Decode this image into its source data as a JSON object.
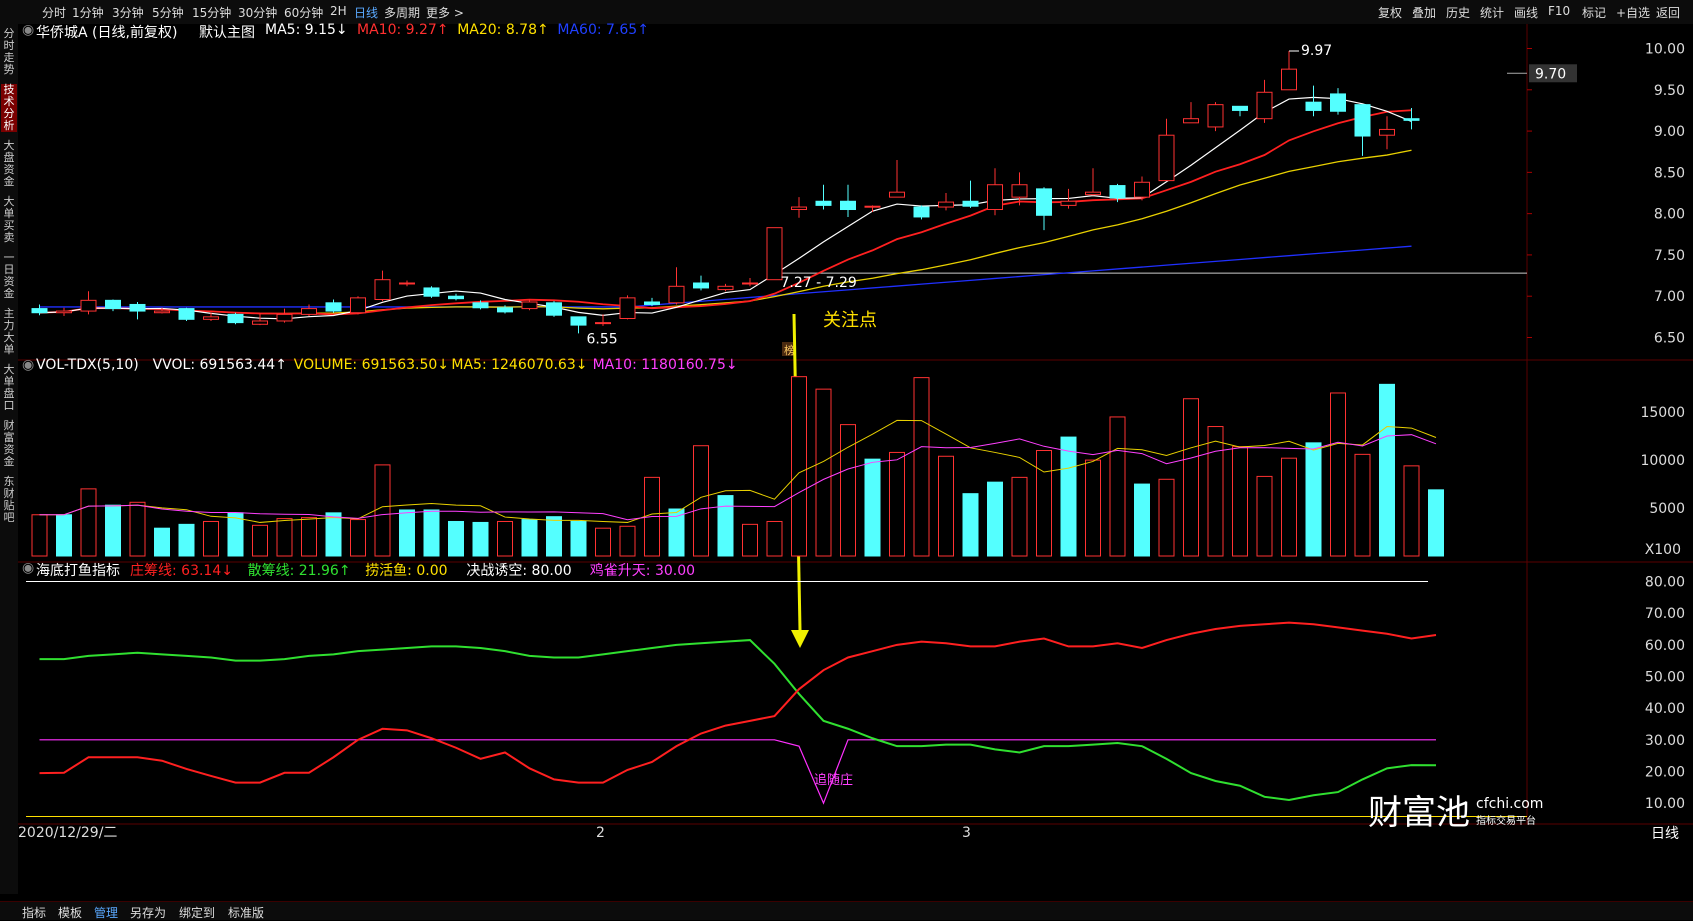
{
  "topbar": {
    "left_items": [
      "分时",
      "1分钟",
      "3分钟",
      "5分钟",
      "15分钟",
      "30分钟",
      "60分钟",
      "2H",
      "日线",
      "多周期",
      "更多 >"
    ],
    "active": "日线",
    "right_items": [
      "复权",
      "叠加",
      "历史",
      "统计",
      "画线",
      "F10",
      "标记",
      "+自选",
      "返回"
    ]
  },
  "side_tabs": [
    "分时走势",
    "技术分析",
    "大盘资金",
    "大单买卖",
    "一日资金",
    "主力大单",
    "大单盘口",
    "财富资金",
    "东财贴吧"
  ],
  "side_active": "技术分析",
  "main_panel": {
    "title": "华侨城A (日线,前复权)",
    "template": "默认主图",
    "indicators": [
      {
        "text": "MA5: 9.15",
        "arrow": "↓",
        "color": "#ffffff"
      },
      {
        "text": "MA10: 9.27",
        "arrow": "↑",
        "color": "#ff3030"
      },
      {
        "text": "MA20: 8.78",
        "arrow": "↑",
        "color": "#ffe000"
      },
      {
        "text": "MA60: 7.65",
        "arrow": "↑",
        "color": "#2040ff"
      }
    ],
    "y_ticks": [
      "10.00",
      "9.50",
      "9.00",
      "8.50",
      "8.00",
      "7.50",
      "7.00",
      "6.50"
    ],
    "y_range": [
      6.3,
      10.2
    ],
    "last_price": "9.70",
    "high_label": "9.97",
    "low_label": "6.55",
    "hline_label": "7.27 - 7.29",
    "annotation": "关注点",
    "badge": "榜"
  },
  "volume_panel": {
    "title": "VOL-TDX(5,10)",
    "indicators": [
      {
        "text": "VVOL: 691563.44",
        "arrow": "↑",
        "color": "#ffffff"
      },
      {
        "text": "VOLUME: 691563.50",
        "arrow": "↓",
        "color": "#ffe000"
      },
      {
        "text": "MA5: 1246070.63",
        "arrow": "↓",
        "color": "#ffe000"
      },
      {
        "text": "MA10: 1180160.75",
        "arrow": "↓",
        "color": "#ff40ff"
      }
    ],
    "y_ticks": [
      "15000",
      "10000",
      "5000"
    ],
    "unit": "X100"
  },
  "indicator_panel": {
    "title": "海底打鱼指标",
    "indicators": [
      {
        "text": "庄筹线: 63.14",
        "arrow": "↓",
        "color": "#ff2020"
      },
      {
        "text": "散筹线: 21.96",
        "arrow": "↑",
        "color": "#30e030"
      },
      {
        "text": "捞活鱼: 0.00",
        "arrow": "",
        "color": "#ffe000"
      },
      {
        "text": "决战诱空: 80.00",
        "arrow": "",
        "color": "#ffffff"
      },
      {
        "text": "鸡雀升天: 30.00",
        "arrow": "",
        "color": "#ff40ff"
      }
    ],
    "y_ticks": [
      "80.00",
      "70.00",
      "60.00",
      "50.00",
      "40.00",
      "30.00",
      "20.00",
      "10.00"
    ],
    "annotation": "追随庄"
  },
  "x_axis": {
    "start": "2020/12/29/二",
    "marks": [
      "2",
      "3"
    ],
    "period": "日线"
  },
  "watermark": {
    "brand": "财富池",
    "site": "cfchi.com",
    "sub": "指标交易平台"
  },
  "bottombar": {
    "items": [
      "指标",
      "模板",
      "管理",
      "另存为",
      "绑定到",
      "标准版"
    ],
    "active": "管理"
  },
  "chart_data": {
    "type": "candlestick",
    "dates_note": "",
    "candles": [
      [
        6.85,
        6.8,
        6.9,
        6.77
      ],
      [
        6.8,
        6.82,
        6.86,
        6.76
      ],
      [
        6.82,
        6.95,
        7.06,
        6.78
      ],
      [
        6.95,
        6.85,
        6.96,
        6.82
      ],
      [
        6.9,
        6.82,
        6.93,
        6.72
      ],
      [
        6.8,
        6.82,
        6.86,
        6.79
      ],
      [
        6.85,
        6.72,
        6.86,
        6.7
      ],
      [
        6.72,
        6.75,
        6.8,
        6.7
      ],
      [
        6.78,
        6.68,
        6.8,
        6.66
      ],
      [
        6.66,
        6.7,
        6.79,
        6.65
      ],
      [
        6.7,
        6.78,
        6.85,
        6.68
      ],
      [
        6.78,
        6.85,
        6.9,
        6.76
      ],
      [
        6.92,
        6.82,
        6.96,
        6.8
      ],
      [
        6.8,
        6.98,
        7.0,
        6.78
      ],
      [
        6.96,
        7.2,
        7.31,
        6.94
      ],
      [
        7.16,
        7.16,
        7.19,
        7.12
      ],
      [
        7.1,
        7.0,
        7.12,
        6.98
      ],
      [
        7.0,
        6.97,
        7.03,
        6.95
      ],
      [
        6.92,
        6.86,
        6.95,
        6.84
      ],
      [
        6.86,
        6.81,
        6.89,
        6.79
      ],
      [
        6.85,
        6.93,
        6.96,
        6.83
      ],
      [
        6.92,
        6.77,
        6.94,
        6.75
      ],
      [
        6.75,
        6.65,
        6.75,
        6.55
      ],
      [
        6.68,
        6.68,
        6.78,
        6.64
      ],
      [
        6.73,
        6.98,
        7.01,
        6.72
      ],
      [
        6.93,
        6.9,
        6.98,
        6.88
      ],
      [
        6.92,
        7.12,
        7.35,
        6.9
      ],
      [
        7.16,
        7.1,
        7.25,
        7.07
      ],
      [
        7.08,
        7.12,
        7.15,
        7.06
      ],
      [
        7.16,
        7.16,
        7.22,
        7.12
      ],
      [
        7.2,
        7.83,
        7.83,
        7.27
      ],
      [
        8.05,
        8.08,
        8.2,
        7.95
      ],
      [
        8.15,
        8.1,
        8.35,
        8.05
      ],
      [
        8.15,
        8.05,
        8.35,
        7.96
      ],
      [
        8.08,
        8.09,
        8.1,
        8.02
      ],
      [
        8.2,
        8.26,
        8.65,
        8.2
      ],
      [
        8.08,
        7.96,
        8.1,
        7.93
      ],
      [
        8.08,
        8.14,
        8.25,
        8.04
      ],
      [
        8.15,
        8.09,
        8.4,
        8.07
      ],
      [
        8.05,
        8.35,
        8.55,
        7.98
      ],
      [
        8.2,
        8.35,
        8.5,
        8.1
      ],
      [
        8.3,
        7.98,
        8.32,
        7.8
      ],
      [
        8.1,
        8.15,
        8.3,
        8.06
      ],
      [
        8.23,
        8.26,
        8.55,
        8.22
      ],
      [
        8.34,
        8.19,
        8.36,
        8.14
      ],
      [
        8.2,
        8.38,
        8.45,
        8.16
      ],
      [
        8.4,
        8.95,
        9.15,
        8.4
      ],
      [
        9.1,
        9.15,
        9.35,
        9.1
      ],
      [
        9.05,
        9.32,
        9.35,
        9.0
      ],
      [
        9.3,
        9.25,
        9.3,
        9.18
      ],
      [
        9.15,
        9.47,
        9.62,
        9.1
      ],
      [
        9.5,
        9.75,
        9.97,
        9.5
      ],
      [
        9.35,
        9.25,
        9.55,
        9.18
      ],
      [
        9.45,
        9.24,
        9.52,
        9.2
      ],
      [
        9.32,
        8.94,
        9.32,
        8.7
      ],
      [
        8.95,
        9.02,
        9.18,
        8.78
      ],
      [
        9.15,
        9.13,
        9.28,
        9.02
      ]
    ],
    "volume": [
      4300,
      4300,
      7000,
      5300,
      5600,
      2900,
      3300,
      3600,
      4500,
      3200,
      3900,
      4000,
      4500,
      3800,
      9500,
      4800,
      4800,
      3600,
      3500,
      3600,
      3800,
      4100,
      3600,
      2900,
      3100,
      8200,
      4900,
      11500,
      6300,
      3300,
      3600,
      18700,
      17400,
      13700,
      10100,
      10800,
      18600,
      10400,
      6500,
      7700,
      8200,
      11000,
      12400,
      10000,
      14500,
      7500,
      8000,
      16400,
      13500,
      11400,
      8300,
      10200,
      11800,
      17000,
      10600,
      17900,
      9400,
      6900
    ],
    "volume_up": [
      0,
      1,
      0,
      1,
      0,
      1,
      1,
      0,
      1,
      0,
      0,
      0,
      1,
      0,
      0,
      1,
      1,
      1,
      1,
      0,
      1,
      1,
      1,
      0,
      0,
      0,
      1,
      0,
      1,
      0,
      0,
      0,
      0,
      0,
      1,
      0,
      0,
      0,
      1,
      1,
      0,
      0,
      1,
      0,
      0,
      1,
      0,
      0,
      0,
      0,
      0,
      0,
      1,
      0,
      0,
      1,
      0,
      1
    ],
    "series": [
      {
        "name": "庄筹线",
        "values": [
          19.5,
          19.6,
          24.5,
          24.5,
          24.5,
          23.4,
          20.8,
          18.6,
          16.5,
          16.5,
          19.6,
          19.6,
          24.5,
          30.0,
          33.5,
          33.0,
          30.5,
          27.5,
          24.0,
          26.0,
          21.0,
          17.5,
          16.5,
          16.5,
          20.5,
          23.0,
          28.0,
          32.0,
          34.5,
          36.0,
          37.5,
          46.0,
          52.0,
          56.0,
          58.0,
          60.0,
          61.0,
          60.5,
          59.5,
          59.5,
          61.0,
          62.0,
          59.5,
          59.5,
          60.5,
          59.0,
          61.5,
          63.5,
          65.0,
          66.0,
          66.5,
          67.0,
          66.5,
          65.5,
          64.5,
          63.5,
          62.0,
          63.1
        ]
      },
      {
        "name": "散筹线",
        "values": [
          55.5,
          55.5,
          56.5,
          57.0,
          57.5,
          57.0,
          56.5,
          56.0,
          55.0,
          55.0,
          55.5,
          56.5,
          57.0,
          58.0,
          58.5,
          59.0,
          59.5,
          59.5,
          59.0,
          58.0,
          56.5,
          56.0,
          56.0,
          57.0,
          58.0,
          59.0,
          60.0,
          60.5,
          61.0,
          61.5,
          54.0,
          44.5,
          36.0,
          33.5,
          30.5,
          28.0,
          28.0,
          28.5,
          28.5,
          27.0,
          26.0,
          28.0,
          28.0,
          28.5,
          29.0,
          28.0,
          24.0,
          19.5,
          17.0,
          15.5,
          12.0,
          11.0,
          12.5,
          13.5,
          17.5,
          21.0,
          22.0,
          21.96
        ]
      },
      {
        "name": "鸡雀升天",
        "values": [
          30,
          30,
          30,
          30,
          30,
          30,
          30,
          30,
          30,
          30,
          30,
          30,
          30,
          30,
          30,
          30,
          30,
          30,
          30,
          30,
          30,
          30,
          30,
          30,
          30,
          30,
          30,
          30,
          30,
          30,
          30,
          28,
          10,
          30,
          30,
          30,
          30,
          30,
          30,
          30,
          30,
          30,
          30,
          30,
          30,
          30,
          30,
          30,
          30,
          30,
          30,
          30,
          30,
          30,
          30,
          30,
          30,
          30
        ]
      },
      {
        "name": "决战诱空",
        "values": [
          80,
          80
        ]
      }
    ]
  }
}
